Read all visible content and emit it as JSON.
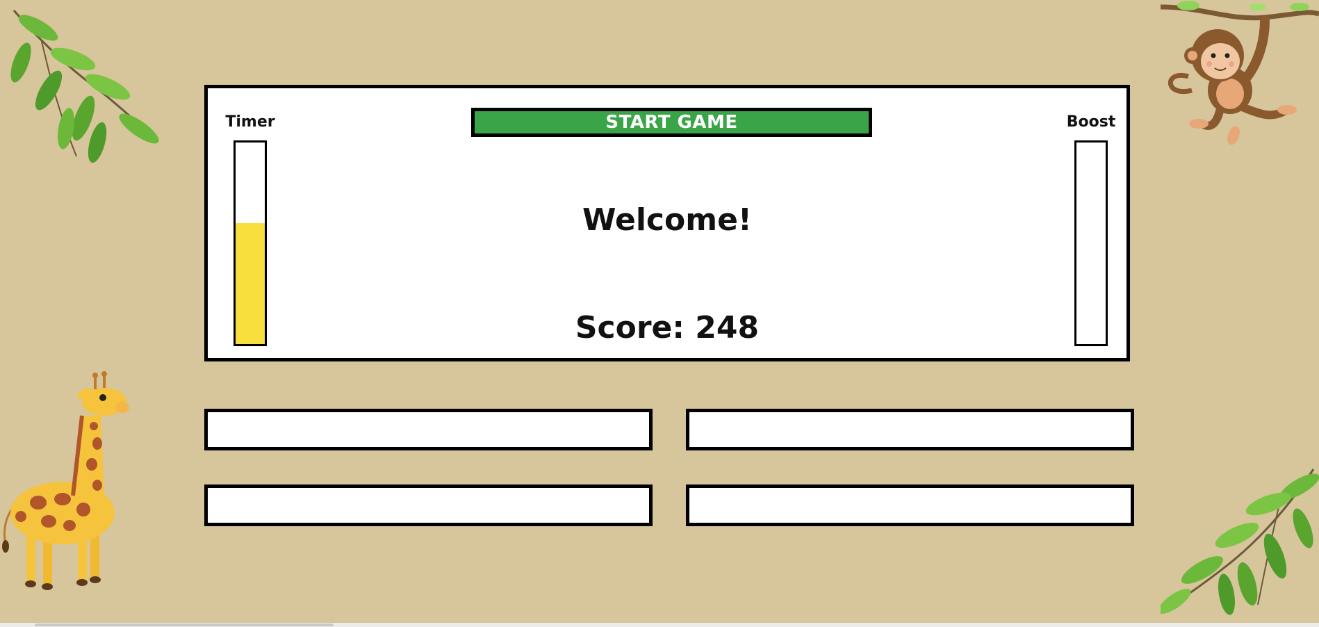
{
  "game": {
    "timer_label": "Timer",
    "boost_label": "Boost",
    "start_button_label": "START GAME",
    "message": "Welcome!",
    "score_text": "Score: 248",
    "timer_level_fraction": 0.6,
    "boost_level_fraction": 0.0
  },
  "answers": [
    {
      "label": ""
    },
    {
      "label": ""
    },
    {
      "label": ""
    },
    {
      "label": ""
    }
  ],
  "decorations": [
    "leaf-branch-top-left",
    "monkey",
    "giraffe",
    "leaf-branch-bottom-right"
  ],
  "colors": {
    "background": "#d7c59b",
    "start_button": "#3aa548",
    "timer_fill": "#f9df3e",
    "boost_fill": "#3aa548"
  }
}
